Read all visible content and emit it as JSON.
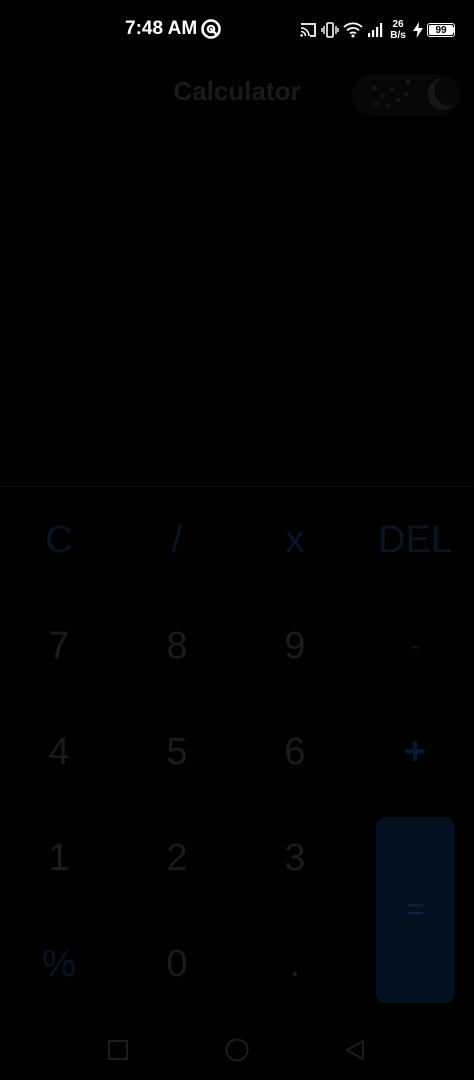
{
  "status_bar": {
    "time": "7:48 AM",
    "net_speed_value": "26",
    "net_speed_unit": "B/s",
    "battery_level": "99"
  },
  "header": {
    "title": "Calculator"
  },
  "keypad": {
    "row1": [
      "C",
      "/",
      "x",
      "DEL"
    ],
    "row2": [
      "7",
      "8",
      "9",
      "-"
    ],
    "row3": [
      "4",
      "5",
      "6",
      "+"
    ],
    "row4": [
      "1",
      "2",
      "3"
    ],
    "row5": [
      "%",
      "0",
      "."
    ],
    "equals": "="
  },
  "colors": {
    "background": "#000000",
    "operator_accent": "#071a33",
    "equals_background": "#03101f"
  }
}
